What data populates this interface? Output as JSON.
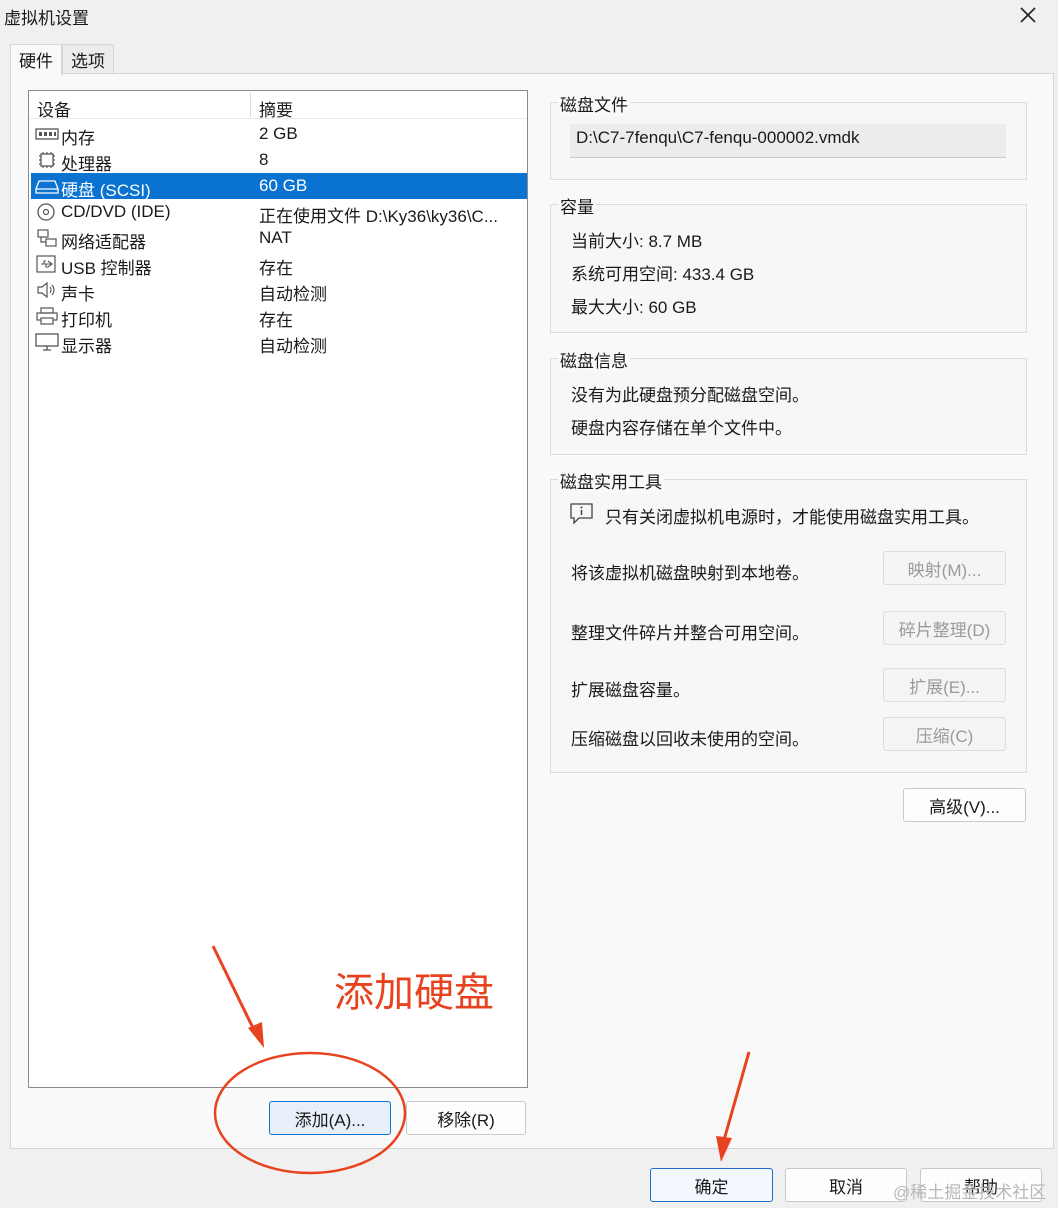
{
  "window": {
    "title": "虚拟机设置"
  },
  "tabs": [
    "硬件",
    "选项"
  ],
  "device_list": {
    "header": {
      "device": "设备",
      "summary": "摘要"
    },
    "rows": [
      {
        "name": "内存",
        "summary": "2 GB",
        "icon": "memory-icon"
      },
      {
        "name": "处理器",
        "summary": "8",
        "icon": "cpu-icon"
      },
      {
        "name": "硬盘 (SCSI)",
        "summary": "60 GB",
        "icon": "hard-disk-icon"
      },
      {
        "name": "CD/DVD (IDE)",
        "summary": "正在使用文件 D:\\Ky36\\ky36\\C...",
        "icon": "cd-dvd-icon"
      },
      {
        "name": "网络适配器",
        "summary": "NAT",
        "icon": "network-icon"
      },
      {
        "name": "USB 控制器",
        "summary": "存在",
        "icon": "usb-icon"
      },
      {
        "name": "声卡",
        "summary": "自动检测",
        "icon": "speaker-icon"
      },
      {
        "name": "打印机",
        "summary": "存在",
        "icon": "printer-icon"
      },
      {
        "name": "显示器",
        "summary": "自动检测",
        "icon": "monitor-icon"
      }
    ],
    "selected_index": 2
  },
  "buttons": {
    "add": "添加(A)...",
    "remove": "移除(R)",
    "ok": "确定",
    "cancel": "取消",
    "help": "帮助",
    "advanced": "高级(V)..."
  },
  "disk_file": {
    "title": "磁盘文件",
    "path": "D:\\C7-7fenqu\\C7-fenqu-000002.vmdk"
  },
  "capacity": {
    "title": "容量",
    "current": "当前大小: 8.7 MB",
    "available": "系统可用空间: 433.4 GB",
    "max": "最大大小: 60 GB"
  },
  "disk_info": {
    "title": "磁盘信息",
    "line1": "没有为此硬盘预分配磁盘空间。",
    "line2": "硬盘内容存储在单个文件中。"
  },
  "disk_utils": {
    "title": "磁盘实用工具",
    "notice": "只有关闭虚拟机电源时，才能使用磁盘实用工具。",
    "map_desc": "将该虚拟机磁盘映射到本地卷。",
    "map_btn": "映射(M)...",
    "defrag_desc": "整理文件碎片并整合可用空间。",
    "defrag_btn": "碎片整理(D)",
    "expand_desc": "扩展磁盘容量。",
    "expand_btn": "扩展(E)...",
    "compact_desc": "压缩磁盘以回收未使用的空间。",
    "compact_btn": "压缩(C)"
  },
  "annotation": {
    "text": "添加硬盘",
    "color": "#e8431f"
  },
  "watermark": "@稀土掘金技术社区",
  "colors": {
    "selection": "#0a73d1",
    "accent_red": "#e8431f"
  }
}
